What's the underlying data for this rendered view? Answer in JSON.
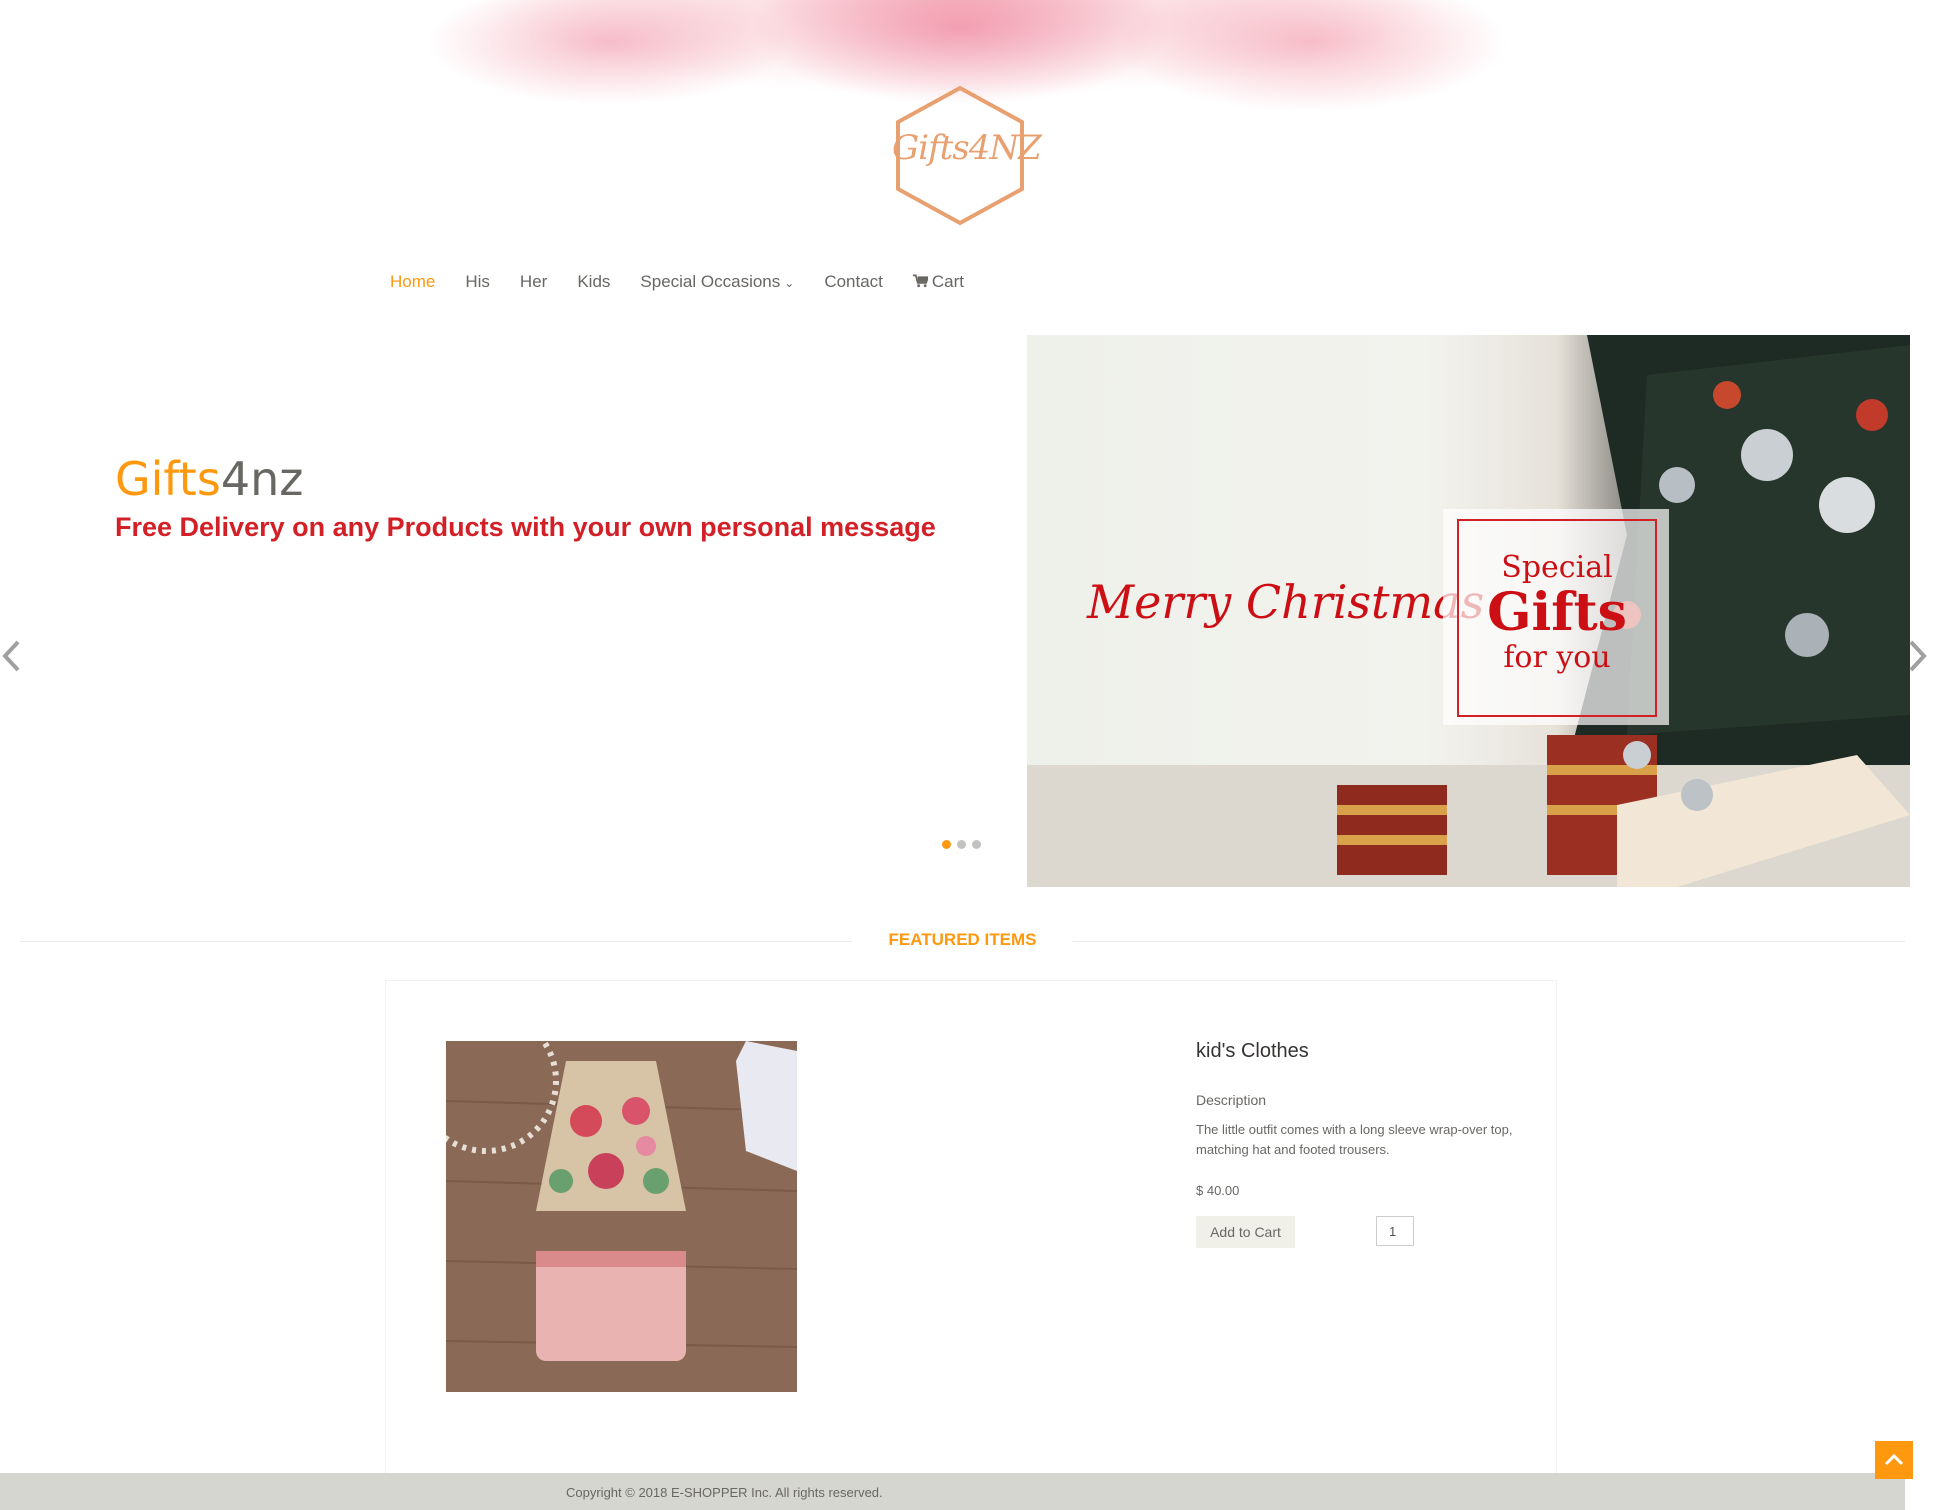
{
  "brand": {
    "logo_text": "Gifts4NZ",
    "slide_title_part1": "Gifts",
    "slide_title_part2": "4nz"
  },
  "nav": {
    "items": [
      {
        "label": "Home",
        "active": true
      },
      {
        "label": "His"
      },
      {
        "label": "Her"
      },
      {
        "label": "Kids"
      },
      {
        "label": "Special Occasions",
        "has_dropdown": true
      },
      {
        "label": "Contact"
      },
      {
        "label": "Cart",
        "icon": "cart-icon"
      }
    ]
  },
  "slider": {
    "subtitle": "Free Delivery on any Products with your own personal message",
    "image_text": {
      "merry": "Merry Christmas",
      "special": "Special",
      "gifts": "Gifts",
      "for_you": "for you"
    },
    "dots": 3,
    "active_dot": 0
  },
  "featured": {
    "title": "Featured Items",
    "product": {
      "name": "kid's Clothes",
      "description_label": "Description",
      "description": "The little outfit comes with a long sleeve wrap-over top, matching hat and footed trousers.",
      "price": "$ 40.00",
      "add_to_cart": "Add to Cart",
      "quantity": "1"
    }
  },
  "footer": {
    "copyright": "Copyright © 2018 E-SHOPPER Inc. All rights reserved."
  },
  "colors": {
    "accent": "#fe980f",
    "promo_red": "#d32027",
    "footer_bg": "#d6d6d0"
  }
}
